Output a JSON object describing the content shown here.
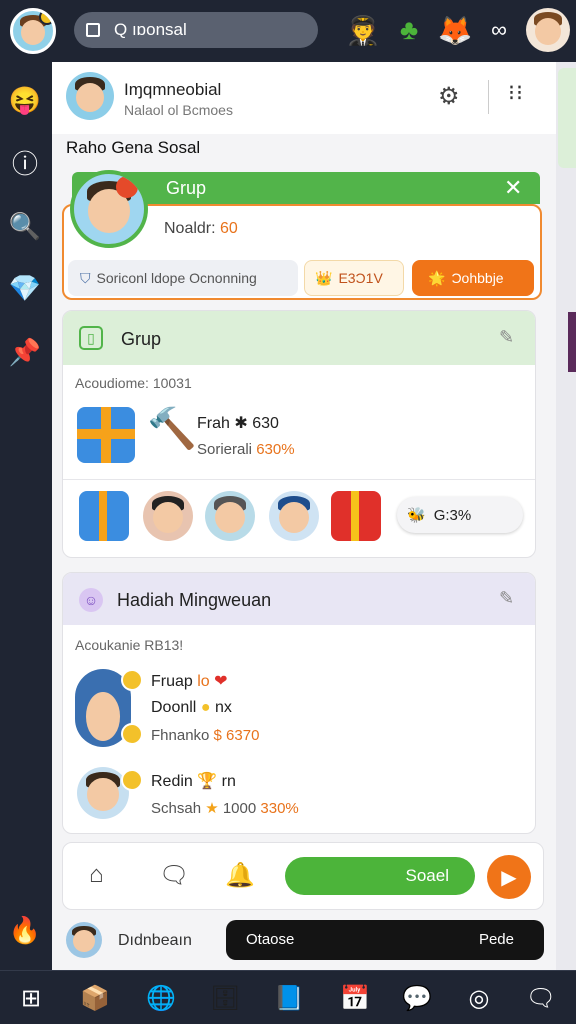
{
  "search": {
    "text": "Q ıɒonsal"
  },
  "header": {
    "name": "Iɱqmneobial",
    "subtitle": "Nalaol ol Bcmoes"
  },
  "section_title": "Raho Gena Sosal",
  "grup_card": {
    "title": "Grup",
    "info_label": "Noaldr:",
    "info_value": "60",
    "chip_left": "Soriconl ldope Ocnonning",
    "chip_mid": "E3Ɔ1V",
    "chip_right": "Ɔohbbje"
  },
  "grup_panel": {
    "title": "Grup",
    "label": "Acoudiome: 10031",
    "line1": "Frah ✱ 630",
    "line2_text": "Sorierali",
    "line2_pct": "630%",
    "pill": "G:3%"
  },
  "weekly": {
    "title": "Hadiah Mingweuan",
    "label": "Acoukanie RB13!",
    "entry1_line1_a": "Fruap",
    "entry1_line1_b": "lo",
    "entry1_line2": "Doonll",
    "entry1_line2_b": "nx",
    "entry1_line3": "Fhnanko",
    "entry1_line3_b": "$ 6370",
    "entry2_line1": "Redin",
    "entry2_line1_b": "rn",
    "entry2_line2": "Schsah",
    "entry2_line2_b": "1000",
    "entry2_line2_c": "330%"
  },
  "actionbar": {
    "send_label": "Soael"
  },
  "userrow": {
    "name": "Dıdnbeaın",
    "bar_left": "Otaose",
    "bar_right": "Pede"
  },
  "colors": {
    "accent_green": "#52b44a",
    "accent_orange": "#f07418",
    "bg_dark": "#1f2533"
  }
}
